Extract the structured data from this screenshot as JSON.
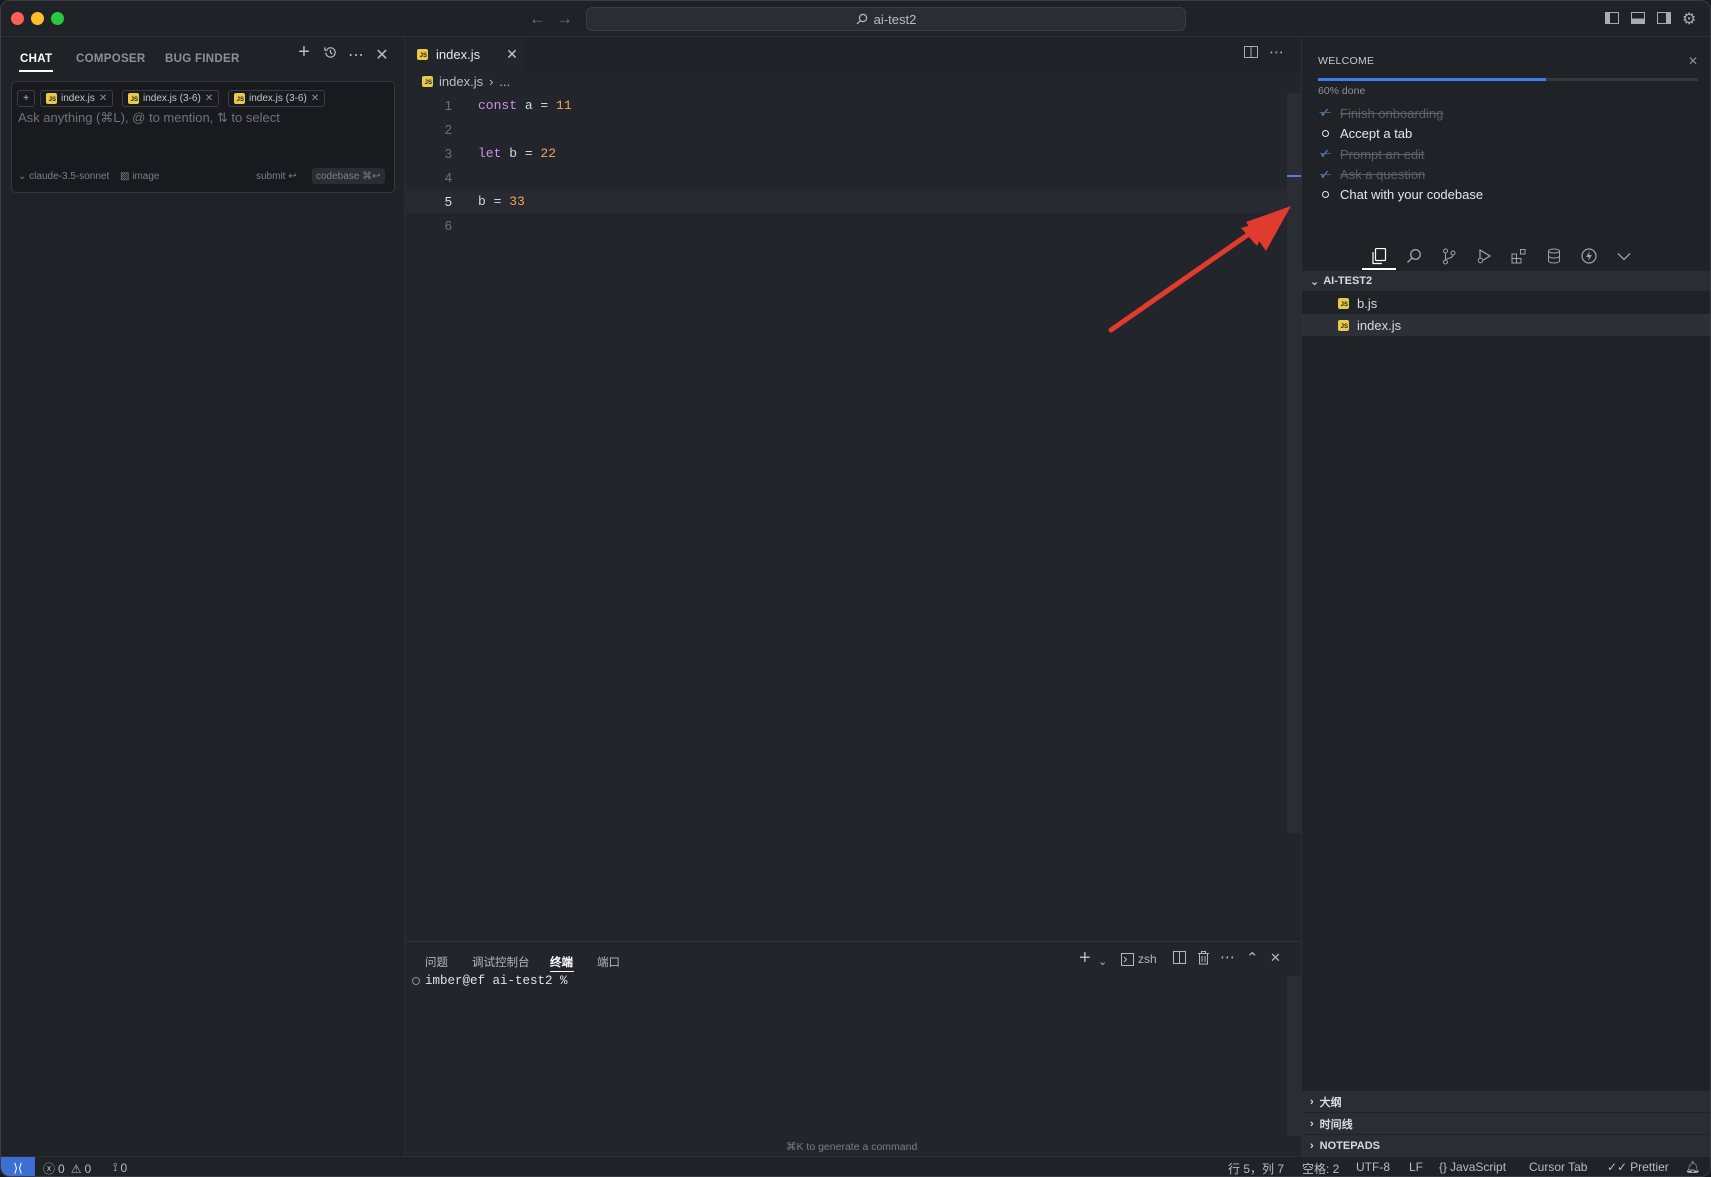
{
  "titlebar": {
    "search_text": "ai-test2"
  },
  "chat": {
    "tabs": [
      "CHAT",
      "COMPOSER",
      "BUG FINDER"
    ],
    "context_chips": [
      "index.js",
      "index.js (3-6)",
      "index.js (3-6)"
    ],
    "placeholder": "Ask anything (⌘L), @ to mention, ⇅ to select",
    "model": "claude-3.5-sonnet",
    "image_label": "image",
    "submit_label": "submit ↩",
    "codebase_label": "codebase ⌘↩"
  },
  "editor": {
    "tab_label": "index.js",
    "breadcrumb_file": "index.js",
    "breadcrumb_rest": "...",
    "lines": [
      {
        "n": "1",
        "tokens": [
          [
            "kw",
            "const"
          ],
          [
            "op",
            " a "
          ],
          [
            "op",
            "="
          ],
          [
            "num",
            " 11"
          ]
        ]
      },
      {
        "n": "2",
        "tokens": []
      },
      {
        "n": "3",
        "tokens": [
          [
            "kw",
            "let"
          ],
          [
            "op",
            " b "
          ],
          [
            "op",
            "="
          ],
          [
            "num",
            " 22"
          ]
        ]
      },
      {
        "n": "4",
        "tokens": []
      },
      {
        "n": "5",
        "tokens": [
          [
            "op",
            "b "
          ],
          [
            "op",
            "="
          ],
          [
            "num",
            " 33"
          ]
        ]
      },
      {
        "n": "6",
        "tokens": []
      }
    ],
    "current_line": 5
  },
  "panel": {
    "tabs": [
      "问题",
      "调试控制台",
      "终端",
      "端口"
    ],
    "active_tab": "终端",
    "shell_label": "zsh",
    "prompt": "imber@ef ai-test2 %",
    "hint": "⌘K to generate a command"
  },
  "welcome": {
    "title": "WELCOME",
    "progress_percent": 60,
    "progress_label": "60% done",
    "items": [
      {
        "label": "Finish onboarding",
        "done": true
      },
      {
        "label": "Accept a tab",
        "done": false
      },
      {
        "label": "Prompt an edit",
        "done": true
      },
      {
        "label": "Ask a question",
        "done": true
      },
      {
        "label": "Chat with your codebase",
        "done": false
      }
    ]
  },
  "explorer": {
    "folder": "AI-TEST2",
    "files": [
      "b.js",
      "index.js"
    ],
    "selected_file": "index.js",
    "sections": [
      "大纲",
      "时间线",
      "NOTEPADS"
    ]
  },
  "statusbar": {
    "errors": "0",
    "warnings": "0",
    "ports": "0",
    "position": "行 5，列 7",
    "indent": "空格: 2",
    "encoding": "UTF-8",
    "eol": "LF",
    "language": "JavaScript",
    "cursor_tab": "Cursor Tab",
    "formatter": "Prettier"
  },
  "colors": {
    "accent": "#3f7ee8",
    "annotation_arrow": "#e03b2e",
    "js_icon": "#e9c94a"
  }
}
